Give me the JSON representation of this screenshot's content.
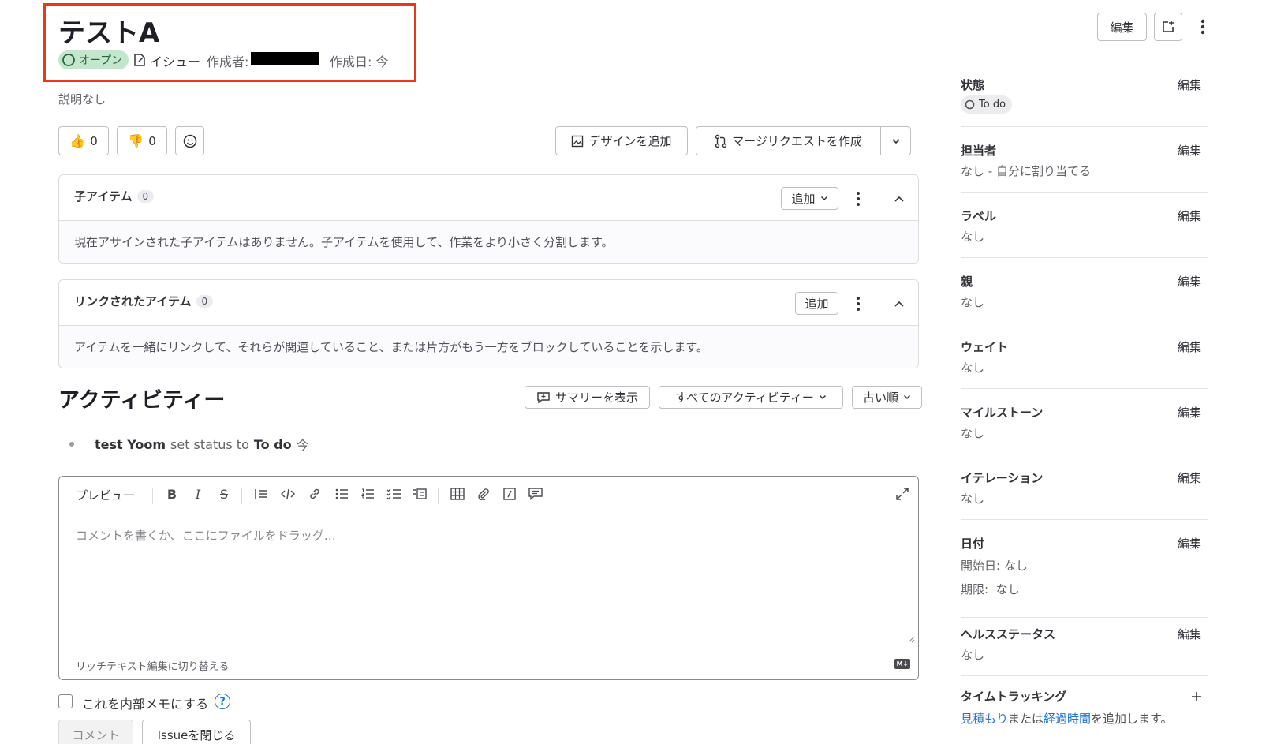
{
  "header": {
    "title": "テストA",
    "status_badge": "オープン",
    "type_label": "イシュー",
    "author_label": "作成者:",
    "created_label": "作成日: 今",
    "description": "説明なし",
    "edit_button": "編集"
  },
  "reactions": {
    "thumbs_up_count": "0",
    "thumbs_down_count": "0"
  },
  "actions": {
    "add_design": "デザインを追加",
    "create_mr": "マージリクエストを作成"
  },
  "child_items": {
    "title": "子アイテム",
    "count": "0",
    "add_label": "追加",
    "empty_text": "現在アサインされた子アイテムはありません。子アイテムを使用して、作業をより小さく分割します。"
  },
  "linked_items": {
    "title": "リンクされたアイテム",
    "count": "0",
    "add_label": "追加",
    "empty_text": "アイテムを一緒にリンクして、それらが関連していること、または片方がもう一方をブロックしていることを示します。"
  },
  "activity": {
    "title": "アクティビティー",
    "summary_button": "サマリーを表示",
    "filter_select": "すべてのアクティビティー",
    "sort_select": "古い順",
    "items": [
      {
        "user": "test Yoom",
        "action": "set status to",
        "value": "To do",
        "time": "今"
      }
    ]
  },
  "editor": {
    "preview_tab": "プレビュー",
    "placeholder": "コメントを書くか、ここにファイルをドラッグ…",
    "switch_mode": "リッチテキスト編集に切り替える",
    "internal_note_label": "これを内部メモにする",
    "comment_button": "コメント",
    "close_issue_button": "Issueを閉じる"
  },
  "sidebar": {
    "edit_label": "編集",
    "status": {
      "title": "状態",
      "value": "To do"
    },
    "assignee": {
      "title": "担当者",
      "value": "なし - 自分に割り当てる"
    },
    "labels": {
      "title": "ラベル",
      "value": "なし"
    },
    "parent": {
      "title": "親",
      "value": "なし"
    },
    "weight": {
      "title": "ウェイト",
      "value": "なし"
    },
    "milestone": {
      "title": "マイルストーン",
      "value": "なし"
    },
    "iteration": {
      "title": "イテレーション",
      "value": "なし"
    },
    "dates": {
      "title": "日付",
      "start": "開始日: なし",
      "due": "期限:  なし"
    },
    "health": {
      "title": "ヘルスステータス",
      "value": "なし"
    },
    "time_tracking": {
      "title": "タイムトラッキング",
      "link_estimate": "見積もり",
      "text_or": "または",
      "link_spent": "経過時間",
      "text_suffix": "を追加します。"
    }
  },
  "colors": {
    "highlight_border": "#e8381b",
    "status_open_bg": "#c3e6cd",
    "status_open_fg": "#24663b",
    "link": "#1f75cb"
  }
}
